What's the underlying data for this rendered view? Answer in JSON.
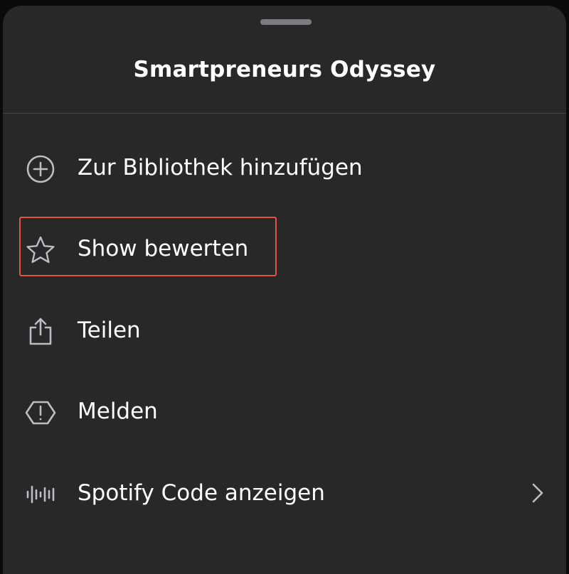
{
  "sheet": {
    "title": "Smartpreneurs Odyssey",
    "items": [
      {
        "label": "Zur Bibliothek hinzufügen",
        "icon": "plus-circle-icon"
      },
      {
        "label": "Show bewerten",
        "icon": "star-icon"
      },
      {
        "label": "Teilen",
        "icon": "share-icon"
      },
      {
        "label": "Melden",
        "icon": "report-icon"
      },
      {
        "label": "Spotify Code anzeigen",
        "icon": "spotify-code-icon",
        "chevron": "chevron-right-icon"
      }
    ]
  },
  "colors": {
    "sheet_background": "#282829",
    "icon": "#bdbdc0",
    "text": "#ffffff",
    "highlight_border": "#e2553d"
  }
}
